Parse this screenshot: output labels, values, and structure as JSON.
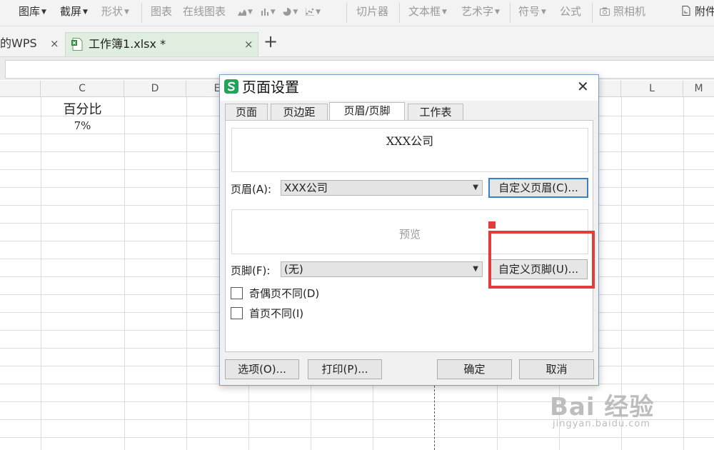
{
  "ribbon": {
    "items": [
      {
        "label": "图库",
        "caret": true,
        "dim": false
      },
      {
        "label": "截屏",
        "caret": true,
        "dim": false
      },
      {
        "label": "形状",
        "caret": true,
        "dim": true
      },
      {
        "label": "图表",
        "caret": false,
        "dim": true
      },
      {
        "label": "在线图表",
        "caret": false,
        "dim": true
      },
      {
        "label": "切片器",
        "caret": false,
        "dim": true
      },
      {
        "label": "文本框",
        "caret": true,
        "dim": true
      },
      {
        "label": "艺术字",
        "caret": true,
        "dim": true
      },
      {
        "label": "符号",
        "caret": true,
        "dim": true
      },
      {
        "label": "公式",
        "caret": false,
        "dim": true
      },
      {
        "label": "照相机",
        "caret": false,
        "dim": true
      },
      {
        "label": "附件",
        "caret": false,
        "dim": false
      }
    ]
  },
  "tabs": {
    "first": "的WPS",
    "second": "工作簿1.xlsx *",
    "close_glyph": "×",
    "new_glyph": "+"
  },
  "grid": {
    "columns": [
      "C",
      "D",
      "E",
      "L",
      "M"
    ],
    "cells": {
      "c1": "百分比",
      "c2": "7%"
    }
  },
  "dialog": {
    "title": "页面设置",
    "close_glyph": "✕",
    "tabs": [
      "页面",
      "页边距",
      "页眉/页脚",
      "工作表"
    ],
    "active_tab": "页眉/页脚",
    "header_preview": "XXX公司",
    "header_label": "页眉(A):",
    "header_value": "XXX公司",
    "custom_header_button": "自定义页眉(C)...",
    "footer_preview": "预览",
    "footer_label": "页脚(F):",
    "footer_value": "(无)",
    "custom_footer_button": "自定义页脚(U)...",
    "checkboxes": [
      {
        "label": "奇偶页不同(D)",
        "checked": false
      },
      {
        "label": "首页不同(I)",
        "checked": false
      }
    ],
    "options_button": "选项(O)...",
    "print_button": "打印(P)...",
    "ok_button": "确定",
    "cancel_button": "取消"
  },
  "watermark": {
    "brand": "Bai 经验",
    "url": "jingyan.baidu.com"
  },
  "colors": {
    "accent_green": "#21a35a",
    "highlight_red": "#e43b3b",
    "focus_blue": "#3b7fc4"
  }
}
